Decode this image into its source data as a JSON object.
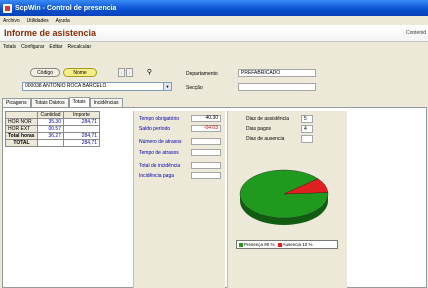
{
  "window": {
    "title": "ScpWin - Control de presencia"
  },
  "menu": [
    "Archivo",
    "Utilidades",
    "Ayuda"
  ],
  "form": {
    "title": "Informe de asistencia",
    "right_label": "Contenid"
  },
  "submenu": [
    "Totals",
    "Configurar",
    "Editar",
    "Recalcular"
  ],
  "buttons": {
    "codigo": "Código",
    "nombre": "Nome"
  },
  "employee": {
    "selected": "000038  ANTONIO ROCA BARCELO"
  },
  "dept": {
    "label": "Departamento",
    "value": "PREFABRICADO",
    "section_label": "Secção",
    "section_value": ""
  },
  "tabs": [
    "Picagens",
    "Totais Diários",
    "Totais",
    "Incidências"
  ],
  "grid": {
    "headers": [
      "",
      "Cantidad",
      "Importe"
    ],
    "rows": [
      {
        "label": "HOR NOR",
        "cantidad": "35.30",
        "importe": "284,71"
      },
      {
        "label": "HOR EXT",
        "cantidad": "00.57",
        "importe": ""
      },
      {
        "label": "Total horas",
        "cantidad": "36.27",
        "importe": "284,71"
      },
      {
        "label": "TOTAL",
        "cantidad": "",
        "importe": "284,71"
      }
    ]
  },
  "middle": [
    {
      "label": "Tempo obrigatório",
      "value": "40.30",
      "color": "#000000"
    },
    {
      "label": "Saldo período",
      "value": "-04.03",
      "color": "#cc0000"
    },
    {
      "label": "Número de atrasos",
      "value": "",
      "color": "#000000"
    },
    {
      "label": "Tempo de atrasos",
      "value": "",
      "color": "#000000"
    },
    {
      "label": "Total de incidência",
      "value": "",
      "color": "#000000"
    },
    {
      "label": "Incidência paga",
      "value": "",
      "color": "#000000"
    }
  ],
  "right": [
    {
      "label": "Dias de assistência",
      "value": "5"
    },
    {
      "label": "Dias pagos",
      "value": "4"
    },
    {
      "label": "Dias de ausencia",
      "value": ""
    }
  ],
  "chart_data": {
    "type": "pie",
    "slices": [
      {
        "name": "Presença",
        "value": 90,
        "color": "#1f9a1f"
      },
      {
        "name": "Ausencia",
        "value": 10,
        "color": "#e02020"
      }
    ],
    "legend": [
      "Presença 90 %",
      "Ausencia 10 %"
    ]
  }
}
